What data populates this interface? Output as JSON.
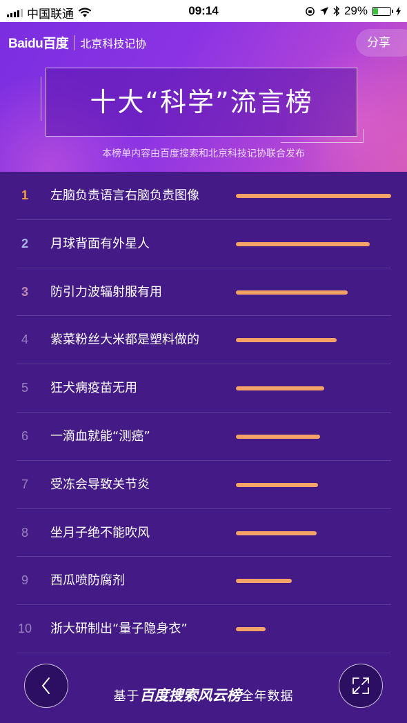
{
  "status_bar": {
    "carrier": "中国联通",
    "time": "09:14",
    "battery": "29%",
    "battery_level": 0.29
  },
  "header": {
    "brand_logo": "Baidu百度",
    "brand_org": "北京科技记协",
    "share_label": "分享",
    "title": "十大“科学”流言榜",
    "subtitle": "本榜单内容由百度搜索和北京科技记协联合发布"
  },
  "list": {
    "bar_color": "#f5a266",
    "items": [
      {
        "rank": "1",
        "label": "左脑负责语言右脑负责图像",
        "level": 1.0
      },
      {
        "rank": "2",
        "label": "月球背面有外星人",
        "level": 0.86
      },
      {
        "rank": "3",
        "label": "防引力波辐射服有用",
        "level": 0.72
      },
      {
        "rank": "4",
        "label": "紫菜粉丝大米都是塑料做的",
        "level": 0.65
      },
      {
        "rank": "5",
        "label": "狂犬病疫苗无用",
        "level": 0.57
      },
      {
        "rank": "6",
        "label": "一滴血就能“测癌”",
        "level": 0.54
      },
      {
        "rank": "7",
        "label": "受冻会导致关节炎",
        "level": 0.53
      },
      {
        "rank": "8",
        "label": "坐月子绝不能吹风",
        "level": 0.52
      },
      {
        "rank": "9",
        "label": "西瓜喷防腐剂",
        "level": 0.36
      },
      {
        "rank": "10",
        "label": "浙大研制出“量子隐身衣”",
        "level": 0.19
      }
    ]
  },
  "footer": {
    "prefix": "基于",
    "brand": "百度搜索风云榜",
    "suffix": "全年数据",
    "back_icon": "chevron-left-icon",
    "expand_icon": "collapse-arrows-icon"
  }
}
